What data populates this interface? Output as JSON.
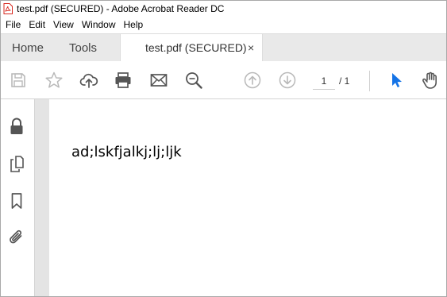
{
  "window": {
    "title": "test.pdf (SECURED) - Adobe Acrobat Reader DC"
  },
  "menu": [
    "File",
    "Edit",
    "View",
    "Window",
    "Help"
  ],
  "tabs": {
    "home": "Home",
    "tools": "Tools",
    "document": "test.pdf (SECURED)",
    "close_glyph": "×"
  },
  "toolbar": {
    "icons": [
      "save-icon",
      "star-icon",
      "upload-cloud-icon",
      "print-icon",
      "email-icon",
      "zoom-search-icon",
      "page-up-icon",
      "page-down-icon",
      "select-cursor-icon",
      "hand-tool-icon"
    ],
    "current_page": "1",
    "page_total": "/ 1"
  },
  "left_rail": {
    "icons": [
      "lock-icon",
      "pages-icon",
      "bookmark-icon",
      "attachment-icon"
    ]
  },
  "document": {
    "text": "ad;lskfjalkj;lj;ljk"
  },
  "colors": {
    "accent": "#1473e6",
    "icon": "#555555",
    "disabled_icon": "#b9b9b9",
    "pdf_red": "#d7281f"
  }
}
